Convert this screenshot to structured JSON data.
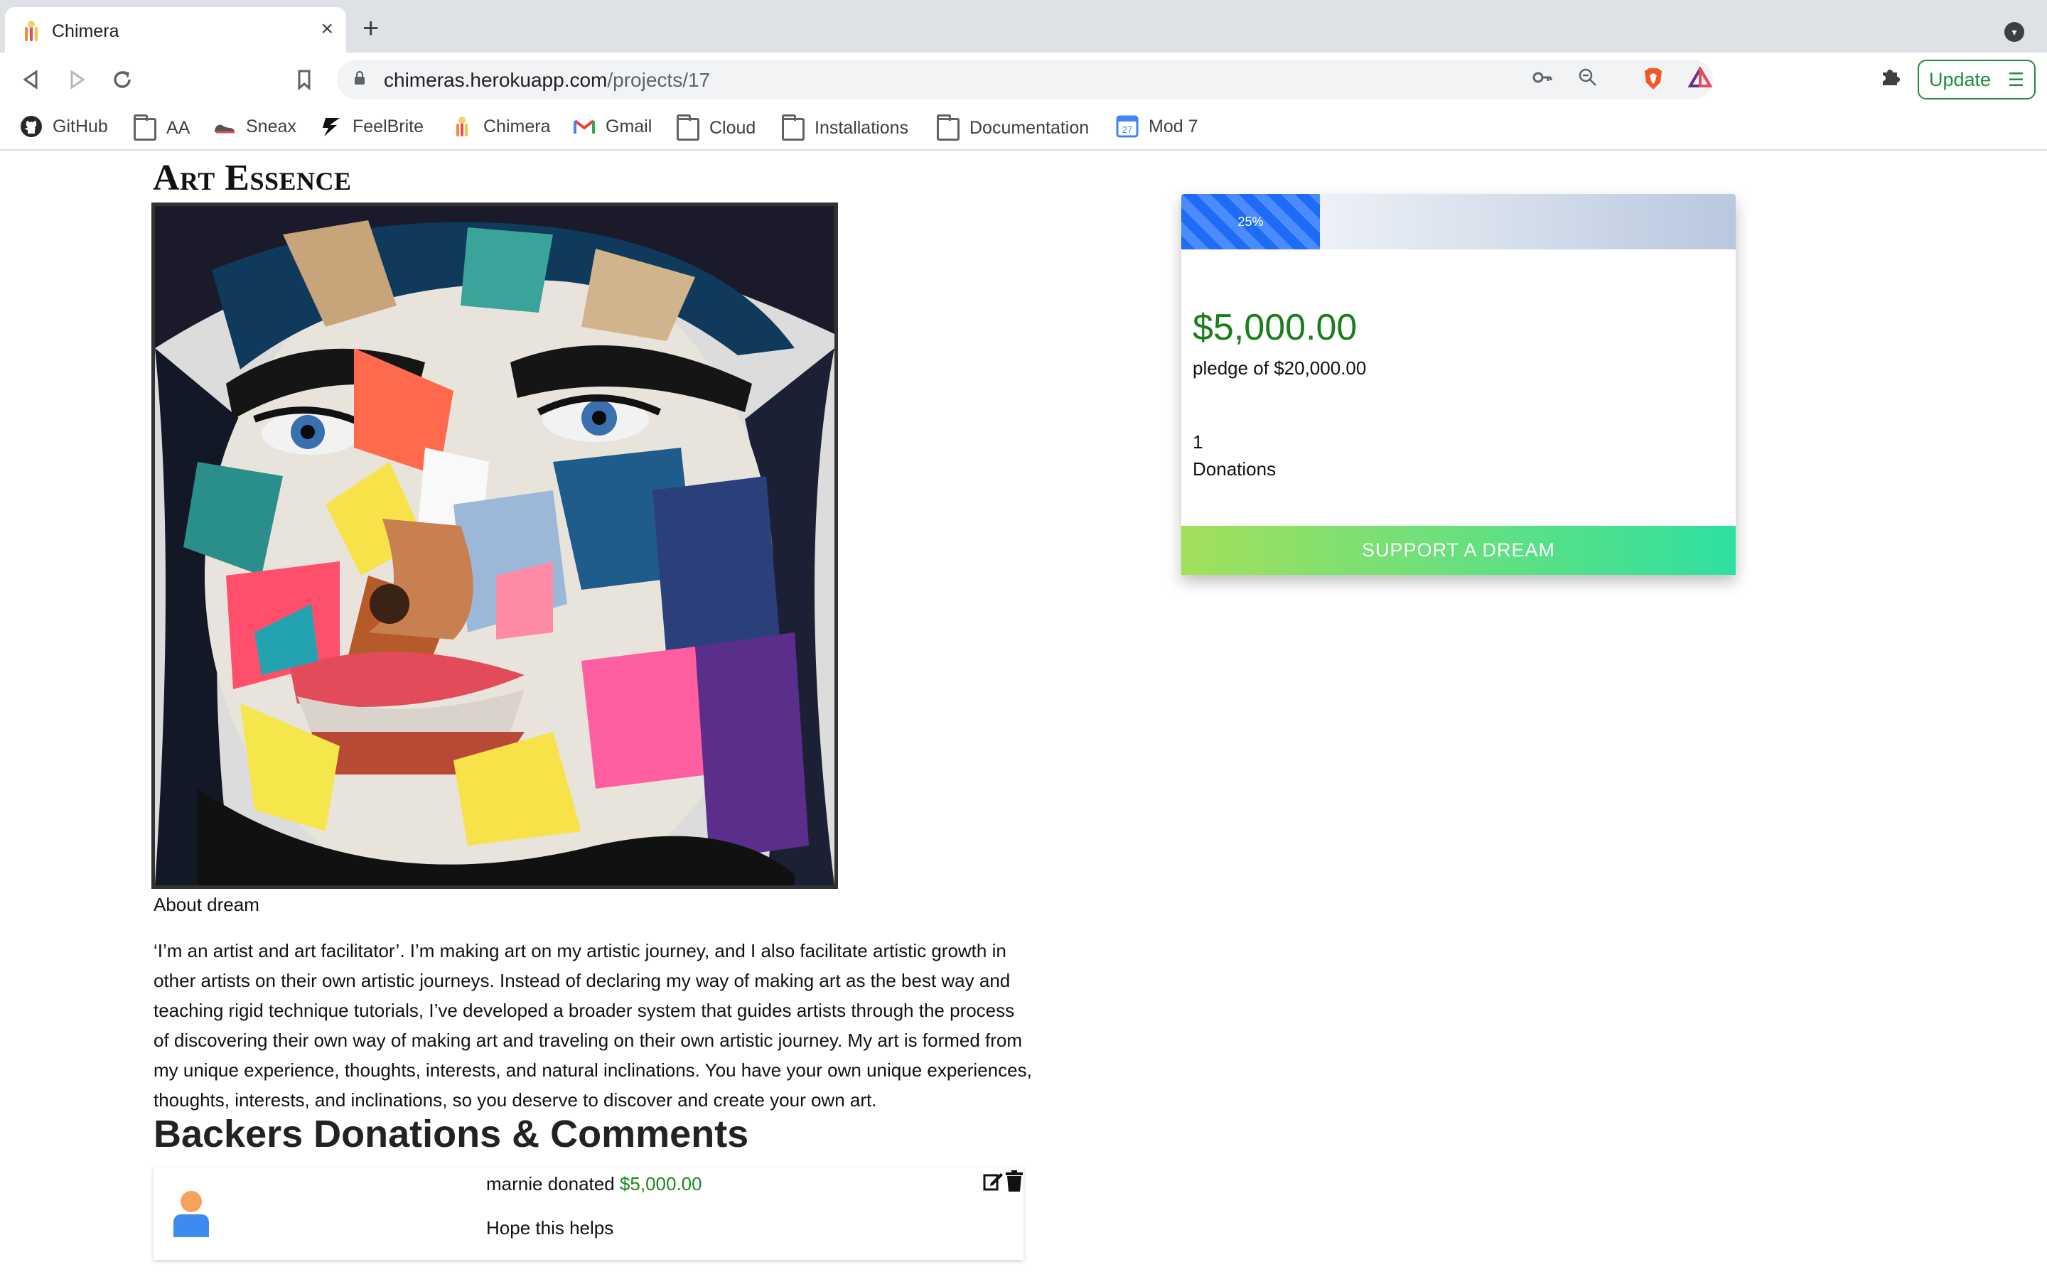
{
  "browser": {
    "tab_title": "Chimera",
    "new_tab": "+",
    "close": "×",
    "url_host": "chimeras.herokuapp.com",
    "url_path": "/projects/17",
    "update_label": "Update",
    "bookmarks": [
      "GitHub",
      "AA",
      "Sneax",
      "FeelBrite",
      "Chimera",
      "Gmail",
      "Cloud",
      "Installations",
      "Documentation",
      "Mod 7"
    ],
    "calendar_day": "27"
  },
  "project": {
    "title": "Art Essence",
    "about_label": "About dream",
    "about_text": "‘I’m an artist and art facilitator’. I’m making art on my artistic journey, and I also facilitate artistic growth in other artists on their own artistic journeys. Instead of declaring my way of making art as the best way and teaching rigid technique tutorials, I’ve developed a broader system that guides artists through the process of discovering their own way of making art and traveling on their own artistic journey. My art is formed from my unique experience, thoughts, interests, and natural inclinations. You have your own unique experiences, thoughts, interests, and inclinations, so you deserve to discover and create your own art."
  },
  "funding": {
    "progress_label": "25%",
    "progress_fraction": 0.25,
    "amount": "$5,000.00",
    "pledge": "pledge of $20,000.00",
    "donations_count": "1",
    "donations_label": "Donations",
    "support_button": "SUPPORT A DREAM"
  },
  "backers": {
    "heading": "Backers Donations & Comments",
    "comments": [
      {
        "donor": "marnie donated",
        "amount": "$5,000.00",
        "text": "Hope this helps"
      }
    ]
  },
  "colors": {
    "money_green": "#1a7f1a",
    "progress_blue": "#1e6bf5",
    "support_gradient_start": "#a3e05a",
    "support_gradient_end": "#2ee0a0"
  }
}
